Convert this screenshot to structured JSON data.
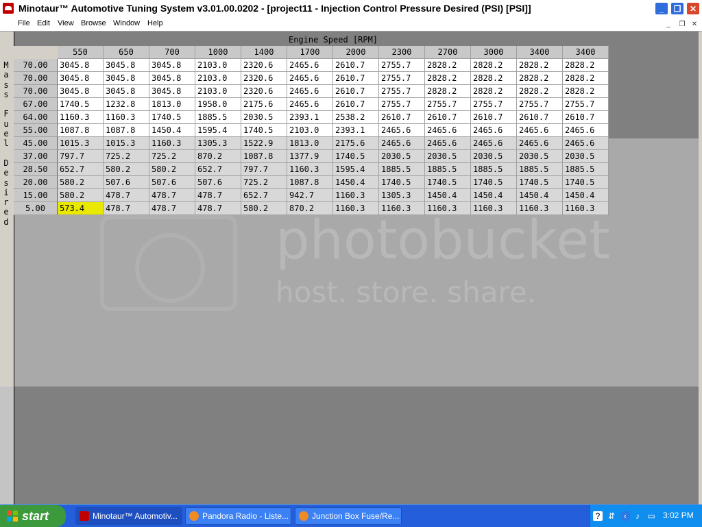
{
  "window": {
    "title": "Minotaur™ Automotive Tuning System  v3.01.00.0202 - [project11 - Injection Control Pressure Desired (PSI) [PSI]]",
    "buttons": [
      "_",
      "❐",
      "✕"
    ]
  },
  "menubar": {
    "items": [
      "File",
      "Edit",
      "View",
      "Browse",
      "Window",
      "Help"
    ],
    "mdi_buttons": [
      "_",
      "❐",
      "✕"
    ]
  },
  "table": {
    "x_axis_title": "Engine Speed [RPM]",
    "y_axis_title": "Mass Fuel Desired",
    "columns": [
      "550",
      "650",
      "700",
      "1000",
      "1400",
      "1700",
      "2000",
      "2300",
      "2700",
      "3000",
      "3400",
      "3400"
    ],
    "rows": [
      {
        "label": "70.00",
        "values": [
          "3045.8",
          "3045.8",
          "3045.8",
          "2103.0",
          "2320.6",
          "2465.6",
          "2610.7",
          "2755.7",
          "2828.2",
          "2828.2",
          "2828.2",
          "2828.2"
        ]
      },
      {
        "label": "70.00",
        "values": [
          "3045.8",
          "3045.8",
          "3045.8",
          "2103.0",
          "2320.6",
          "2465.6",
          "2610.7",
          "2755.7",
          "2828.2",
          "2828.2",
          "2828.2",
          "2828.2"
        ]
      },
      {
        "label": "70.00",
        "values": [
          "3045.8",
          "3045.8",
          "3045.8",
          "2103.0",
          "2320.6",
          "2465.6",
          "2610.7",
          "2755.7",
          "2828.2",
          "2828.2",
          "2828.2",
          "2828.2"
        ]
      },
      {
        "label": "67.00",
        "values": [
          "1740.5",
          "1232.8",
          "1813.0",
          "1958.0",
          "2175.6",
          "2465.6",
          "2610.7",
          "2755.7",
          "2755.7",
          "2755.7",
          "2755.7",
          "2755.7"
        ]
      },
      {
        "label": "64.00",
        "values": [
          "1160.3",
          "1160.3",
          "1740.5",
          "1885.5",
          "2030.5",
          "2393.1",
          "2538.2",
          "2610.7",
          "2610.7",
          "2610.7",
          "2610.7",
          "2610.7"
        ]
      },
      {
        "label": "55.00",
        "values": [
          "1087.8",
          "1087.8",
          "1450.4",
          "1595.4",
          "1740.5",
          "2103.0",
          "2393.1",
          "2465.6",
          "2465.6",
          "2465.6",
          "2465.6",
          "2465.6"
        ]
      },
      {
        "label": "45.00",
        "values": [
          "1015.3",
          "1015.3",
          "1160.3",
          "1305.3",
          "1522.9",
          "1813.0",
          "2175.6",
          "2465.6",
          "2465.6",
          "2465.6",
          "2465.6",
          "2465.6"
        ]
      },
      {
        "label": "37.00",
        "values": [
          "797.7",
          "725.2",
          "725.2",
          "870.2",
          "1087.8",
          "1377.9",
          "1740.5",
          "2030.5",
          "2030.5",
          "2030.5",
          "2030.5",
          "2030.5"
        ]
      },
      {
        "label": "28.50",
        "values": [
          "652.7",
          "580.2",
          "580.2",
          "652.7",
          "797.7",
          "1160.3",
          "1595.4",
          "1885.5",
          "1885.5",
          "1885.5",
          "1885.5",
          "1885.5"
        ]
      },
      {
        "label": "20.00",
        "values": [
          "580.2",
          "507.6",
          "507.6",
          "507.6",
          "725.2",
          "1087.8",
          "1450.4",
          "1740.5",
          "1740.5",
          "1740.5",
          "1740.5",
          "1740.5"
        ]
      },
      {
        "label": "15.00",
        "values": [
          "580.2",
          "478.7",
          "478.7",
          "478.7",
          "652.7",
          "942.7",
          "1160.3",
          "1305.3",
          "1450.4",
          "1450.4",
          "1450.4",
          "1450.4"
        ]
      },
      {
        "label": "5.00",
        "values": [
          "573.4",
          "478.7",
          "478.7",
          "478.7",
          "580.2",
          "870.2",
          "1160.3",
          "1160.3",
          "1160.3",
          "1160.3",
          "1160.3",
          "1160.3"
        ]
      }
    ],
    "selected": {
      "row": 11,
      "col": 0
    },
    "colors": {
      "selected": "#e8e800",
      "white_cell": "#ffffff",
      "gray_cell": "#d8d8d8",
      "header": "#c8c8c8"
    }
  },
  "watermark": {
    "line1": "photobucket",
    "line2": "host. store. share."
  },
  "taskbar": {
    "start_label": "start",
    "tasks": [
      {
        "label": "Minotaur™ Automotiv...",
        "icon": "app-icon",
        "active": true
      },
      {
        "label": "Pandora Radio - Liste...",
        "icon": "firefox-icon",
        "active": false
      },
      {
        "label": "Junction Box Fuse/Re...",
        "icon": "firefox-icon",
        "active": false
      }
    ],
    "tray_icons": [
      "help-icon",
      "network-icon",
      "chevron-icon",
      "volume-icon",
      "monitor-icon"
    ],
    "clock": "3:02 PM"
  }
}
